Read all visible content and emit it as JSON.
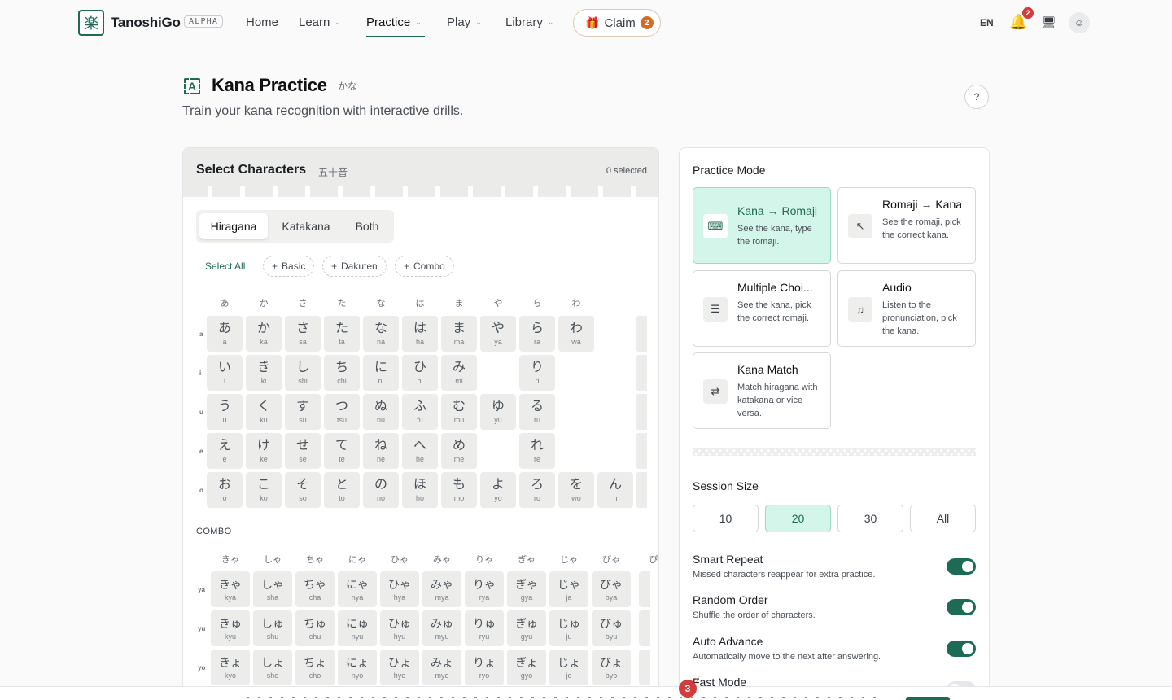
{
  "nav": {
    "brand": "TanoshiGo",
    "badge": "ALPHA",
    "items": [
      {
        "label": "Home",
        "dropdown": false
      },
      {
        "label": "Learn",
        "dropdown": true
      },
      {
        "label": "Practice",
        "dropdown": true,
        "active": true
      },
      {
        "label": "Play",
        "dropdown": true
      },
      {
        "label": "Library",
        "dropdown": true
      }
    ],
    "claim_label": "Claim",
    "claim_count": "2",
    "language": "EN",
    "notification_count": "2"
  },
  "header": {
    "title": "Kana Practice",
    "title_jp": "かな",
    "description": "Train your kana recognition with interactive drills."
  },
  "select": {
    "title": "Select Characters",
    "title_jp": "五十音",
    "selected_text": "0 selected",
    "tabs": [
      "Hiragana",
      "Katakana",
      "Both"
    ],
    "select_all": "Select All",
    "chips": [
      "Basic",
      "Dakuten",
      "Combo"
    ],
    "columns": [
      "あ",
      "か",
      "さ",
      "た",
      "な",
      "は",
      "ま",
      "や",
      "ら",
      "わ"
    ],
    "rows": [
      {
        "label": "a",
        "cells": [
          [
            "あ",
            "a"
          ],
          [
            "か",
            "ka"
          ],
          [
            "さ",
            "sa"
          ],
          [
            "た",
            "ta"
          ],
          [
            "な",
            "na"
          ],
          [
            "は",
            "ha"
          ],
          [
            "ま",
            "ma"
          ],
          [
            "や",
            "ya"
          ],
          [
            "ら",
            "ra"
          ],
          [
            "わ",
            "wa"
          ]
        ]
      },
      {
        "label": "i",
        "cells": [
          [
            "い",
            "i"
          ],
          [
            "き",
            "ki"
          ],
          [
            "し",
            "shi"
          ],
          [
            "ち",
            "chi"
          ],
          [
            "に",
            "ni"
          ],
          [
            "ひ",
            "hi"
          ],
          [
            "み",
            "mi"
          ],
          null,
          [
            "り",
            "ri"
          ],
          null
        ]
      },
      {
        "label": "u",
        "cells": [
          [
            "う",
            "u"
          ],
          [
            "く",
            "ku"
          ],
          [
            "す",
            "su"
          ],
          [
            "つ",
            "tsu"
          ],
          [
            "ぬ",
            "nu"
          ],
          [
            "ふ",
            "fu"
          ],
          [
            "む",
            "mu"
          ],
          [
            "ゆ",
            "yu"
          ],
          [
            "る",
            "ru"
          ],
          null
        ]
      },
      {
        "label": "e",
        "cells": [
          [
            "え",
            "e"
          ],
          [
            "け",
            "ke"
          ],
          [
            "せ",
            "se"
          ],
          [
            "て",
            "te"
          ],
          [
            "ね",
            "ne"
          ],
          [
            "へ",
            "he"
          ],
          [
            "め",
            "me"
          ],
          null,
          [
            "れ",
            "re"
          ],
          null
        ]
      },
      {
        "label": "o",
        "cells": [
          [
            "お",
            "o"
          ],
          [
            "こ",
            "ko"
          ],
          [
            "そ",
            "so"
          ],
          [
            "と",
            "to"
          ],
          [
            "の",
            "no"
          ],
          [
            "ほ",
            "ho"
          ],
          [
            "も",
            "mo"
          ],
          [
            "よ",
            "yo"
          ],
          [
            "ろ",
            "ro"
          ],
          [
            "を",
            "wo"
          ],
          [
            "ん",
            "n"
          ]
        ]
      }
    ],
    "combo_label": "COMBO",
    "combo_columns": [
      "きゃ",
      "しゃ",
      "ちゃ",
      "にゃ",
      "ひゃ",
      "みゃ",
      "りゃ",
      "ぎゃ",
      "じゃ",
      "びゃ",
      "ぴ"
    ],
    "combo_rows": [
      {
        "label": "ya",
        "cells": [
          [
            "きゃ",
            "kya"
          ],
          [
            "しゃ",
            "sha"
          ],
          [
            "ちゃ",
            "cha"
          ],
          [
            "にゃ",
            "nya"
          ],
          [
            "ひゃ",
            "hya"
          ],
          [
            "みゃ",
            "mya"
          ],
          [
            "りゃ",
            "rya"
          ],
          [
            "ぎゃ",
            "gya"
          ],
          [
            "じゃ",
            "ja"
          ],
          [
            "びゃ",
            "bya"
          ]
        ]
      },
      {
        "label": "yu",
        "cells": [
          [
            "きゅ",
            "kyu"
          ],
          [
            "しゅ",
            "shu"
          ],
          [
            "ちゅ",
            "chu"
          ],
          [
            "にゅ",
            "nyu"
          ],
          [
            "ひゅ",
            "hyu"
          ],
          [
            "みゅ",
            "myu"
          ],
          [
            "りゅ",
            "ryu"
          ],
          [
            "ぎゅ",
            "gyu"
          ],
          [
            "じゅ",
            "ju"
          ],
          [
            "びゅ",
            "byu"
          ]
        ]
      },
      {
        "label": "yo",
        "cells": [
          [
            "きょ",
            "kyo"
          ],
          [
            "しょ",
            "sho"
          ],
          [
            "ちょ",
            "cho"
          ],
          [
            "にょ",
            "nyo"
          ],
          [
            "ひょ",
            "hyo"
          ],
          [
            "みょ",
            "myo"
          ],
          [
            "りょ",
            "ryo"
          ],
          [
            "ぎょ",
            "gyo"
          ],
          [
            "じょ",
            "jo"
          ],
          [
            "びょ",
            "byo"
          ]
        ]
      }
    ]
  },
  "practice": {
    "title": "Practice Mode",
    "modes": [
      {
        "title": "Kana → Romaji",
        "desc": "See the kana, type the romaji.",
        "icon": "keyboard-icon",
        "active": true
      },
      {
        "title": "Romaji → Kana",
        "desc": "See the romaji, pick the correct kana.",
        "icon": "pointer-icon"
      },
      {
        "title": "Multiple Choi...",
        "desc": "See the kana, pick the correct romaji.",
        "icon": "checklist-icon"
      },
      {
        "title": "Audio",
        "desc": "Listen to the pronunciation, pick the kana.",
        "icon": "speaker-icon"
      },
      {
        "title": "Kana Match",
        "desc": "Match hiragana with katakana or vice versa.",
        "icon": "swap-icon"
      }
    ],
    "session_title": "Session Size",
    "sizes": [
      "10",
      "20",
      "30",
      "All"
    ],
    "selected_size": "20",
    "options": [
      {
        "title": "Smart Repeat",
        "desc": "Missed characters reappear for extra practice.",
        "on": true
      },
      {
        "title": "Random Order",
        "desc": "Shuffle the order of characters.",
        "on": true
      },
      {
        "title": "Auto Advance",
        "desc": "Automatically move to the next after answering.",
        "on": true
      },
      {
        "title": "Fast Mode",
        "desc": "",
        "on": false
      }
    ],
    "step_badge": "3"
  }
}
